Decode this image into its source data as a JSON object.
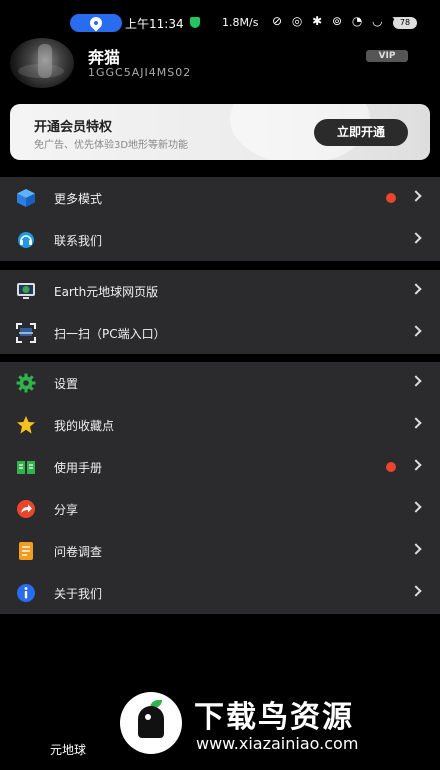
{
  "status_bar": {
    "time": "上午11:34",
    "net_speed": "1.8M/s",
    "icons_text": "⊘ ◎ ✱ ⊚ ◔ ◡ ◥",
    "battery": "78"
  },
  "profile": {
    "name": "奔猫",
    "id": "1GGC5AJI4MS02",
    "vip_label": "VIP"
  },
  "member_card": {
    "title": "开通会员特权",
    "subtitle": "免广告、优先体验3D地形等新功能",
    "button": "立即开通"
  },
  "menu_groups": [
    [
      {
        "label": "更多模式",
        "icon": "cube-icon",
        "dot": true
      },
      {
        "label": "联系我们",
        "icon": "headset-icon",
        "dot": false
      }
    ],
    [
      {
        "label": "Earth元地球网页版",
        "icon": "monitor-globe-icon",
        "dot": false
      },
      {
        "label": "扫一扫（PC端入口）",
        "icon": "scan-icon",
        "dot": false
      }
    ],
    [
      {
        "label": "设置",
        "icon": "gear-icon",
        "dot": false
      },
      {
        "label": "我的收藏点",
        "icon": "star-icon",
        "dot": false
      },
      {
        "label": "使用手册",
        "icon": "book-icon",
        "dot": true
      },
      {
        "label": "分享",
        "icon": "share-icon",
        "dot": false
      },
      {
        "label": "问卷调查",
        "icon": "survey-icon",
        "dot": false
      },
      {
        "label": "关于我们",
        "icon": "info-icon",
        "dot": false
      }
    ]
  ],
  "bottom_label": "元地球",
  "watermark": {
    "title": "下载鸟资源",
    "url": "www.xiazainiao.com"
  },
  "colors": {
    "accent_blue": "#2a6cf0",
    "badge_red": "#e8452c",
    "panel": "#2b2b2d"
  }
}
